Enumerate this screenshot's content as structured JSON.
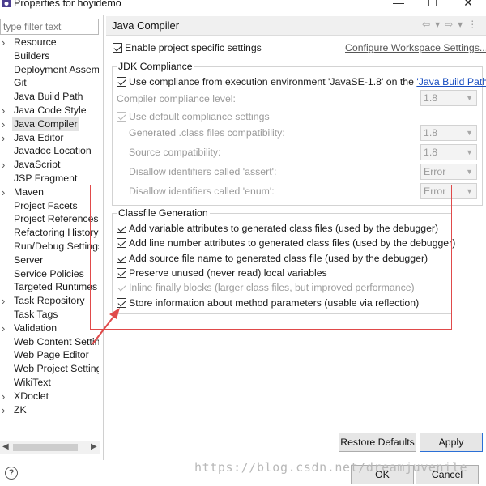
{
  "window": {
    "title": "Properties for hoyidemo",
    "controls": {
      "minimize": "—",
      "maximize": "☐",
      "close": "✕"
    }
  },
  "filter": {
    "placeholder": "type filter text",
    "value": ""
  },
  "tree": {
    "items": [
      {
        "label": "Resource",
        "expandable": true,
        "selected": false
      },
      {
        "label": "Builders",
        "expandable": false,
        "selected": false
      },
      {
        "label": "Deployment Assem",
        "expandable": false,
        "selected": false
      },
      {
        "label": "Git",
        "expandable": false,
        "selected": false
      },
      {
        "label": "Java Build Path",
        "expandable": false,
        "selected": false
      },
      {
        "label": "Java Code Style",
        "expandable": true,
        "selected": false
      },
      {
        "label": "Java Compiler",
        "expandable": true,
        "selected": true
      },
      {
        "label": "Java Editor",
        "expandable": true,
        "selected": false
      },
      {
        "label": "Javadoc Location",
        "expandable": false,
        "selected": false
      },
      {
        "label": "JavaScript",
        "expandable": true,
        "selected": false
      },
      {
        "label": "JSP Fragment",
        "expandable": false,
        "selected": false
      },
      {
        "label": "Maven",
        "expandable": true,
        "selected": false
      },
      {
        "label": "Project Facets",
        "expandable": false,
        "selected": false
      },
      {
        "label": "Project References",
        "expandable": false,
        "selected": false
      },
      {
        "label": "Refactoring History",
        "expandable": false,
        "selected": false
      },
      {
        "label": "Run/Debug Settings",
        "expandable": false,
        "selected": false
      },
      {
        "label": "Server",
        "expandable": false,
        "selected": false
      },
      {
        "label": "Service Policies",
        "expandable": false,
        "selected": false
      },
      {
        "label": "Targeted Runtimes",
        "expandable": false,
        "selected": false
      },
      {
        "label": "Task Repository",
        "expandable": true,
        "selected": false
      },
      {
        "label": "Task Tags",
        "expandable": false,
        "selected": false
      },
      {
        "label": "Validation",
        "expandable": true,
        "selected": false
      },
      {
        "label": "Web Content Settin",
        "expandable": false,
        "selected": false
      },
      {
        "label": "Web Page Editor",
        "expandable": false,
        "selected": false
      },
      {
        "label": "Web Project Setting",
        "expandable": false,
        "selected": false
      },
      {
        "label": "WikiText",
        "expandable": false,
        "selected": false
      },
      {
        "label": "XDoclet",
        "expandable": true,
        "selected": false
      },
      {
        "label": "ZK",
        "expandable": true,
        "selected": false
      }
    ]
  },
  "page": {
    "title": "Java Compiler",
    "enable_specific": {
      "label": "Enable project specific settings",
      "checked": true
    },
    "configure_link": "Configure Workspace Settings...",
    "jdk": {
      "title": "JDK Compliance",
      "use_env": {
        "label": "Use compliance from execution environment 'JavaSE-1.8' on the ",
        "link": "'Java Build Path'",
        "checked": true
      },
      "compliance_level": {
        "label": "Compiler compliance level:",
        "value": "1.8"
      },
      "use_default": {
        "label": "Use default compliance settings",
        "checked": true
      },
      "generated": {
        "label": "Generated .class files compatibility:",
        "value": "1.8"
      },
      "source": {
        "label": "Source compatibility:",
        "value": "1.8"
      },
      "assert": {
        "label": "Disallow identifiers called 'assert':",
        "value": "Error"
      },
      "enum": {
        "label": "Disallow identifiers called 'enum':",
        "value": "Error"
      }
    },
    "classfile": {
      "title": "Classfile Generation",
      "options": [
        {
          "label": "Add variable attributes to generated class files (used by the debugger)",
          "checked": true,
          "disabled": false
        },
        {
          "label": "Add line number attributes to generated class files (used by the debugger)",
          "checked": true,
          "disabled": false
        },
        {
          "label": "Add source file name to generated class file (used by the debugger)",
          "checked": true,
          "disabled": false
        },
        {
          "label": "Preserve unused (never read) local variables",
          "checked": true,
          "disabled": false
        },
        {
          "label": "Inline finally blocks (larger class files, but improved performance)",
          "checked": true,
          "disabled": true
        },
        {
          "label": "Store information about method parameters (usable via reflection)",
          "checked": true,
          "disabled": false
        }
      ]
    }
  },
  "buttons": {
    "restore_defaults": "Restore Defaults",
    "apply": "Apply",
    "ok": "OK",
    "cancel": "Cancel"
  },
  "help_icon": "?",
  "watermark": "https://blog.csdn.net/dreamjuvenile",
  "annotation_color": "#e04a4a"
}
